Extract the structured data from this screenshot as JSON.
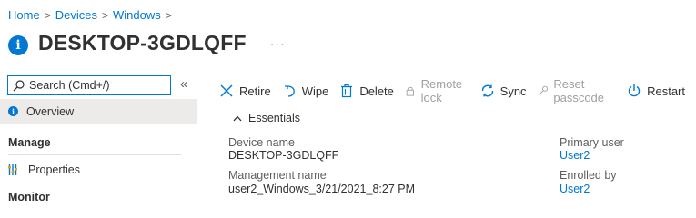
{
  "breadcrumb": {
    "items": [
      "Home",
      "Devices",
      "Windows"
    ],
    "separator": ">"
  },
  "header": {
    "title": "DESKTOP-3GDLQFF",
    "more": "···"
  },
  "sidebar": {
    "search_placeholder": "Search (Cmd+/)",
    "collapse": "«",
    "overview_label": "Overview",
    "manage_heading": "Manage",
    "properties_label": "Properties",
    "monitor_heading": "Monitor"
  },
  "toolbar": {
    "retire": "Retire",
    "wipe": "Wipe",
    "delete": "Delete",
    "remote_lock": "Remote lock",
    "sync": "Sync",
    "reset_passcode": "Reset passcode",
    "restart": "Restart"
  },
  "essentials": {
    "heading": "Essentials",
    "device_name_label": "Device name",
    "device_name_value": "DESKTOP-3GDLQFF",
    "management_name_label": "Management name",
    "management_name_value": "user2_Windows_3/21/2021_8:27 PM",
    "primary_user_label": "Primary user",
    "primary_user_value": "User2",
    "enrolled_by_label": "Enrolled by",
    "enrolled_by_value": "User2"
  },
  "colors": {
    "accent": "#0078d4",
    "text": "#323130",
    "disabled": "#a19f9d",
    "selected_bg": "#edebe9"
  },
  "icons": [
    "info-icon",
    "search-icon",
    "x-icon",
    "wipe-icon",
    "trash-icon",
    "lock-icon",
    "sync-icon",
    "key-icon",
    "power-icon",
    "chevron-up-icon",
    "properties-icon"
  ]
}
